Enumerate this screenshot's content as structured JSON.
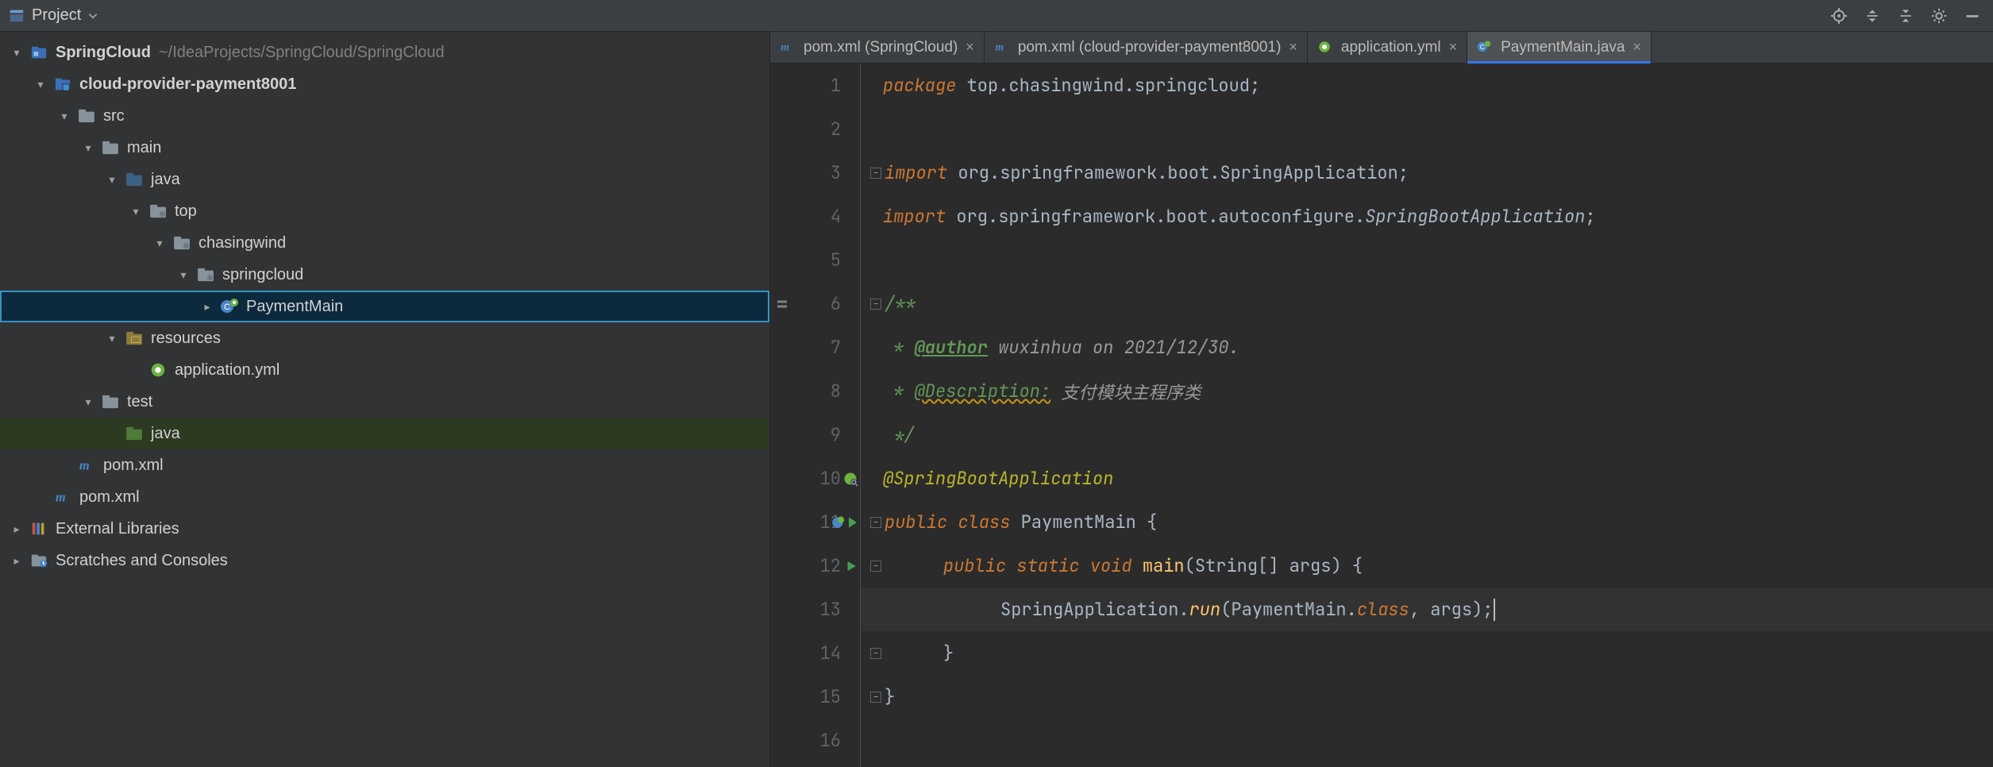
{
  "toolwindow": {
    "title": "Project"
  },
  "tree": {
    "root": {
      "label": "SpringCloud",
      "path": "~/IdeaProjects/SpringCloud/SpringCloud"
    },
    "module": {
      "label": "cloud-provider-payment8001"
    },
    "src": {
      "label": "src"
    },
    "main": {
      "label": "main"
    },
    "java_main": {
      "label": "java"
    },
    "pkg_top": {
      "label": "top"
    },
    "pkg_chasing": {
      "label": "chasingwind"
    },
    "pkg_spring": {
      "label": "springcloud"
    },
    "payment_main": {
      "label": "PaymentMain"
    },
    "resources": {
      "label": "resources"
    },
    "app_yml": {
      "label": "application.yml"
    },
    "test": {
      "label": "test"
    },
    "java_test": {
      "label": "java"
    },
    "pom_module": {
      "label": "pom.xml"
    },
    "pom_root": {
      "label": "pom.xml"
    },
    "ext_lib": {
      "label": "External Libraries"
    },
    "scratches": {
      "label": "Scratches and Consoles"
    }
  },
  "tabs": [
    {
      "label": "pom.xml (SpringCloud)"
    },
    {
      "label": "pom.xml (cloud-provider-payment8001)"
    },
    {
      "label": "application.yml"
    },
    {
      "label": "PaymentMain.java"
    }
  ],
  "code": {
    "l1_kw": "package",
    "l1_rest": " top.chasingwind.springcloud;",
    "l3_kw": "import",
    "l3_rest_a": " org.springframework.boot.",
    "l3_rest_b": "SpringApplication",
    "l3_rest_c": ";",
    "l4_kw": "import",
    "l4_rest_a": " org.springframework.boot.autoconfigure.",
    "l4_rest_b": "SpringBootApplication",
    "l4_rest_c": ";",
    "l6": "/**",
    "l7_pre": " * ",
    "l7_tag": "@author",
    "l7_txt": " wuxinhua on 2021/12/30.",
    "l8_pre": " * ",
    "l8_tag": "@Description:",
    "l8_txt": " 支付模块主程序类",
    "l9": " */",
    "l10": "@SpringBootApplication",
    "l11_a": "public",
    "l11_b": " class",
    "l11_c": " PaymentMain ",
    "l11_d": "{",
    "l12_a": "public",
    "l12_b": " static",
    "l12_c": " void",
    "l12_d": " main",
    "l12_e": "(",
    "l12_f": "String",
    "l12_g": "[] ",
    "l12_h": "args",
    "l12_i": ") {",
    "l13_a": "SpringApplication",
    "l13_b": ".",
    "l13_c": "run",
    "l13_d": "(",
    "l13_e": "PaymentMain",
    "l13_f": ".",
    "l13_g": "class",
    "l13_h": ", ",
    "l13_i": "args",
    "l13_j": ");",
    "l14": "}",
    "l15": "}"
  },
  "lines": [
    "1",
    "2",
    "3",
    "4",
    "5",
    "6",
    "7",
    "8",
    "9",
    "10",
    "11",
    "12",
    "13",
    "14",
    "15",
    "16"
  ]
}
